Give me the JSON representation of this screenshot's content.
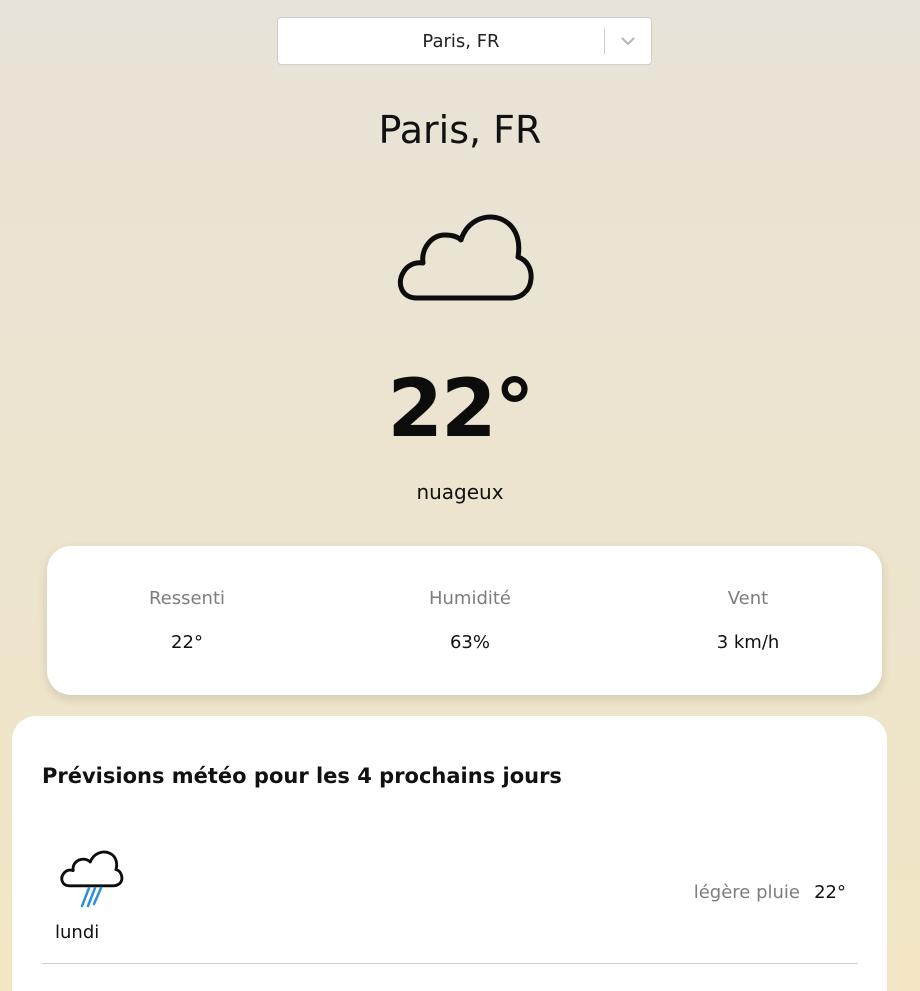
{
  "city_select": {
    "value": "Paris, FR"
  },
  "current": {
    "city": "Paris, FR",
    "icon": "cloud-icon",
    "temperature": "22°",
    "description": "nuageux"
  },
  "stats": {
    "feels_like": {
      "label": "Ressenti",
      "value": "22°"
    },
    "humidity": {
      "label": "Humidité",
      "value": "63%"
    },
    "wind": {
      "label": "Vent",
      "value": "3 km/h"
    }
  },
  "forecast": {
    "title": "Prévisions météo pour les 4 prochains jours",
    "days": [
      {
        "day": "lundi",
        "icon": "rain-cloud-icon",
        "description": "légère pluie",
        "temperature": "22°"
      }
    ]
  },
  "colors": {
    "rain": "#2f8fd6",
    "muted_text": "#7d7d7d"
  }
}
